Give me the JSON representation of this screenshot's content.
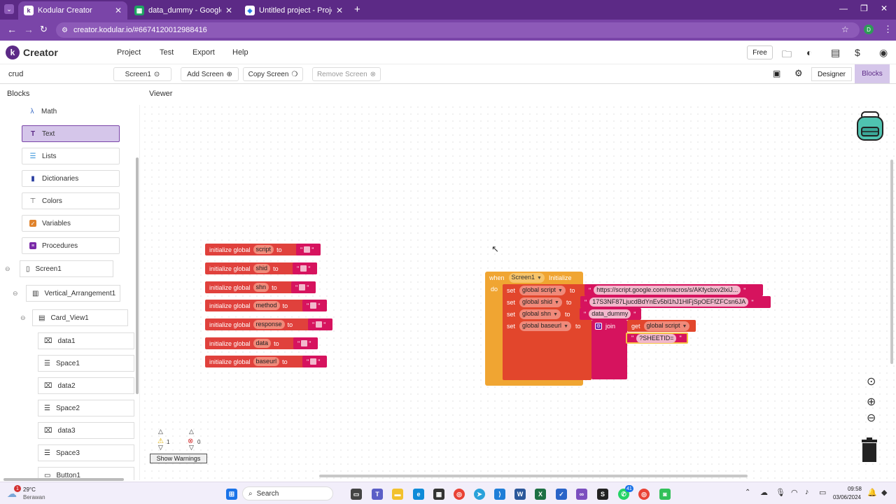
{
  "browser": {
    "tabs": [
      {
        "title": "Kodular Creator",
        "icon": "kodular-icon"
      },
      {
        "title": "data_dummy - Google Sheets",
        "icon": "sheets-icon"
      },
      {
        "title": "Untitled project - Project Editor",
        "icon": "apps-script-icon"
      }
    ],
    "url": "creator.kodular.io/#6674120012988416",
    "profile_initial": "D"
  },
  "app": {
    "brand": "Creator",
    "menu": [
      "Project",
      "Test",
      "Export",
      "Help"
    ],
    "plan_badge": "Free"
  },
  "toolbar": {
    "project_name": "crud",
    "screen_selector": "Screen1",
    "add_screen": "Add Screen",
    "copy_screen": "Copy Screen",
    "remove_screen": "Remove Screen",
    "designer": "Designer",
    "blocks": "Blocks"
  },
  "panels": {
    "blocks_title": "Blocks",
    "viewer_title": "Viewer"
  },
  "palette": [
    {
      "label": "Math",
      "icon": "lambda-icon",
      "color": "#3a6bc4"
    },
    {
      "label": "Text",
      "icon": "text-icon",
      "color": "#5c2a86",
      "selected": true
    },
    {
      "label": "Lists",
      "icon": "list-icon",
      "color": "#2f8fd8"
    },
    {
      "label": "Dictionaries",
      "icon": "dictionary-icon",
      "color": "#2a3ea0"
    },
    {
      "label": "Colors",
      "icon": "paint-roller-icon",
      "color": "#555"
    },
    {
      "label": "Variables",
      "icon": "checkbox-icon",
      "color": "#e0832c"
    },
    {
      "label": "Procedures",
      "icon": "procedures-icon",
      "color": "#7a2aa8"
    }
  ],
  "tree": [
    {
      "label": "Screen1",
      "icon": "phone-icon"
    },
    {
      "label": "Vertical_Arrangement1",
      "icon": "vertical-arrangement-icon"
    },
    {
      "label": "Card_View1",
      "icon": "card-icon"
    },
    {
      "label": "data1",
      "icon": "textbox-icon"
    },
    {
      "label": "Space1",
      "icon": "space-icon"
    },
    {
      "label": "data2",
      "icon": "textbox-icon"
    },
    {
      "label": "Space2",
      "icon": "space-icon"
    },
    {
      "label": "data3",
      "icon": "textbox-icon"
    },
    {
      "label": "Space3",
      "icon": "space-icon"
    },
    {
      "label": "Button1",
      "icon": "button-icon"
    }
  ],
  "globals": {
    "keyword": "initialize global",
    "to": "to",
    "names": [
      "script",
      "shid",
      "shn",
      "method",
      "response",
      "data",
      "baseurl"
    ]
  },
  "event": {
    "when": "when",
    "component": "Screen1",
    "event": "Initialize",
    "do": "do",
    "set": "set",
    "to": "to",
    "assignments": [
      {
        "var": "global script",
        "value": "https://script.google.com/macros/s/AKfycbxv2lxiJ..."
      },
      {
        "var": "global shid",
        "value": "17S3NF87LjucdBdYnEv5bl1hJ1HlFjSpOEFfZFCsn6JA"
      },
      {
        "var": "global shn",
        "value": "data_dummy"
      },
      {
        "var": "global baseurl",
        "value": ""
      }
    ],
    "join": "join",
    "get": "get",
    "get_var": "global script",
    "join_text": "?SHEETID="
  },
  "warnings": {
    "warning_count": "1",
    "error_count": "0",
    "button": "Show Warnings"
  },
  "taskbar": {
    "weather_temp": "29°C",
    "weather_desc": "Berawan",
    "weather_badge": "1",
    "search_placeholder": "Search",
    "time": "09:58",
    "date": "03/06/2024",
    "whatsapp_badge": "41"
  }
}
